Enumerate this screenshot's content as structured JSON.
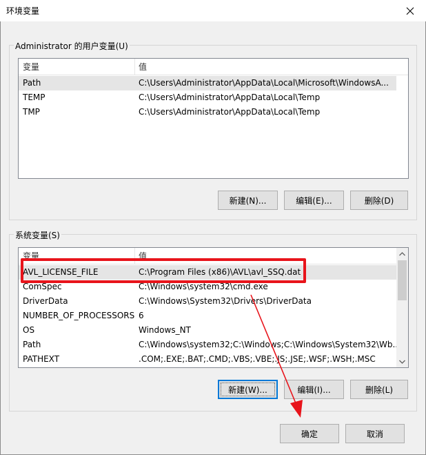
{
  "window": {
    "title": "环境变量"
  },
  "user_vars": {
    "label": "Administrator 的用户变量(U)",
    "columns": [
      "变量",
      "值"
    ],
    "rows": [
      [
        "Path",
        "C:\\Users\\Administrator\\AppData\\Local\\Microsoft\\WindowsA..."
      ],
      [
        "TEMP",
        "C:\\Users\\Administrator\\AppData\\Local\\Temp"
      ],
      [
        "TMP",
        "C:\\Users\\Administrator\\AppData\\Local\\Temp"
      ]
    ],
    "buttons": {
      "new": "新建(N)...",
      "edit": "编辑(E)...",
      "delete": "删除(D)"
    }
  },
  "system_vars": {
    "label": "系统变量(S)",
    "columns": [
      "变量",
      "值"
    ],
    "rows": [
      [
        "AVL_LICENSE_FILE",
        "C:\\Program Files (x86)\\AVL\\avl_SSQ.dat"
      ],
      [
        "ComSpec",
        "C:\\Windows\\system32\\cmd.exe"
      ],
      [
        "DriverData",
        "C:\\Windows\\System32\\Drivers\\DriverData"
      ],
      [
        "NUMBER_OF_PROCESSORS",
        "6"
      ],
      [
        "OS",
        "Windows_NT"
      ],
      [
        "Path",
        "C:\\Windows\\system32;C:\\Windows;C:\\Windows\\System32\\Wb..."
      ],
      [
        "PATHEXT",
        ".COM;.EXE;.BAT;.CMD;.VBS;.VBE;.JS;.JSE;.WSF;.WSH;.MSC"
      ]
    ],
    "buttons": {
      "new": "新建(W)...",
      "edit": "编辑(I)...",
      "delete": "删除(L)"
    }
  },
  "footer": {
    "ok": "确定",
    "cancel": "取消"
  },
  "colors": {
    "annotation": "#e8141b",
    "focus": "#0078d7"
  }
}
